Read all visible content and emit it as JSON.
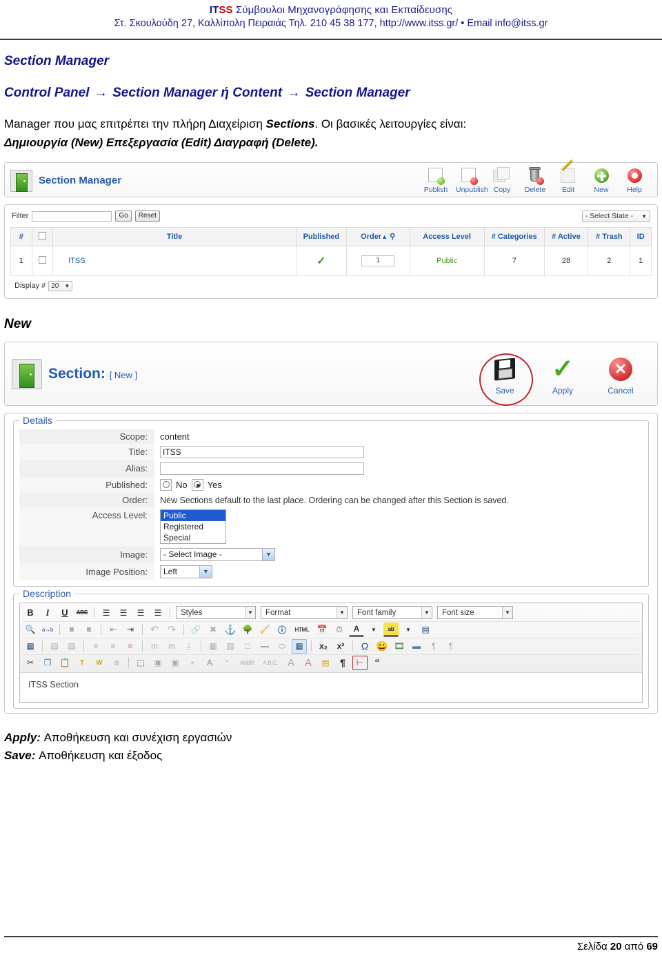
{
  "header": {
    "brand_it": "IT",
    "brand_ss": "SS",
    "line1_rest": " Σύμβουλοι Μηχανογράφησης και Εκπαίδευσης",
    "line2": "Στ. Σκουλούδη 27, Καλλίπολη Πειραιάς Τηλ. 210 45 38 177, http://www.itss.gr/ •  Email info@itss.gr"
  },
  "doc": {
    "title": "Section Manager",
    "breadcrumb_part1": "Control Panel ",
    "breadcrumb_arrow": "→",
    "breadcrumb_part2": " Section Manager ή Content ",
    "breadcrumb_part3": " Section Manager",
    "paragraph_1a": "Manager που μας επιτρέπει την πλήρη Διαχείριση ",
    "paragraph_1b": "Sections",
    "paragraph_1c": ". Οι βασικές λειτουργίες είναι:",
    "paragraph_2": "Δημιουργία (New) Επεξεργασία (Edit) Διαγραφή (Delete).",
    "section_new_heading": "New"
  },
  "section_manager": {
    "title": "Section Manager",
    "toolbar": [
      {
        "label": "Publish",
        "icon": "publish-icon"
      },
      {
        "label": "Unpublish",
        "icon": "unpublish-icon"
      },
      {
        "label": "Copy",
        "icon": "copy-icon"
      },
      {
        "label": "Delete",
        "icon": "delete-icon"
      },
      {
        "label": "Edit",
        "icon": "edit-icon"
      },
      {
        "label": "New",
        "icon": "new-icon"
      },
      {
        "label": "Help",
        "icon": "help-icon"
      }
    ],
    "filter": {
      "label": "Filter",
      "value": "",
      "go_label": "Go",
      "reset_label": "Reset",
      "state_select": "- Select State -"
    },
    "columns": [
      "#",
      "",
      "Title",
      "Published",
      "Order",
      "Access Level",
      "# Categories",
      "# Active",
      "# Trash",
      "ID"
    ],
    "order_sort_arrow": "▲",
    "rows": [
      {
        "num": "1",
        "title": "ITSS",
        "published": "✓",
        "order": "1",
        "access_level": "Public",
        "categories": "7",
        "active": "28",
        "trash": "2",
        "id": "1"
      }
    ],
    "display_label": "Display #",
    "display_value": "20"
  },
  "section_edit": {
    "title": "Section:",
    "title_sub": "[ New ]",
    "actions": [
      {
        "label": "Save",
        "icon": "save-floppy-icon"
      },
      {
        "label": "Apply",
        "icon": "apply-check-icon"
      },
      {
        "label": "Cancel",
        "icon": "cancel-x-icon"
      }
    ],
    "details": {
      "legend": "Details",
      "scope_label": "Scope:",
      "scope_value": "content",
      "title_label": "Title:",
      "title_value": "ITSS",
      "alias_label": "Alias:",
      "alias_value": "",
      "published_label": "Published:",
      "published_no": "No",
      "published_yes": "Yes",
      "order_label": "Order:",
      "order_hint": "New Sections default to the last place. Ordering can be changed after this Section is saved.",
      "access_label": "Access Level:",
      "access_options": [
        "Public",
        "Registered",
        "Special"
      ],
      "access_selected": "Public",
      "image_label": "Image:",
      "image_value": "- Select Image -",
      "image_position_label": "Image Position:",
      "image_position_value": "Left"
    },
    "description": {
      "legend": "Description",
      "dropdowns": [
        "Styles",
        "Format",
        "Font family",
        "Font size"
      ],
      "row1_buttons": [
        {
          "icon": "bold-icon",
          "glyph": "B"
        },
        {
          "icon": "italic-icon",
          "glyph": "I"
        },
        {
          "icon": "underline-icon",
          "glyph": "U"
        },
        {
          "icon": "strikethrough-icon",
          "glyph": "ABC"
        },
        {
          "icon": "align-left-icon",
          "glyph": "≡"
        },
        {
          "icon": "align-center-icon",
          "glyph": "≡"
        },
        {
          "icon": "align-right-icon",
          "glyph": "≡"
        },
        {
          "icon": "align-justify-icon",
          "glyph": "≡"
        }
      ],
      "row2_buttons": [
        {
          "icon": "search-icon",
          "glyph": "🔍"
        },
        {
          "icon": "replace-icon",
          "glyph": "ab"
        },
        {
          "icon": "bullet-list-icon",
          "glyph": "☰"
        },
        {
          "icon": "numbered-list-icon",
          "glyph": "☰"
        },
        {
          "icon": "outdent-icon",
          "glyph": "⇤"
        },
        {
          "icon": "indent-icon",
          "glyph": "⇥"
        },
        {
          "icon": "undo-icon",
          "glyph": "↶"
        },
        {
          "icon": "redo-icon",
          "glyph": "↷"
        },
        {
          "icon": "link-icon",
          "glyph": "🔗"
        },
        {
          "icon": "unlink-icon",
          "glyph": "✂"
        },
        {
          "icon": "anchor-icon",
          "glyph": "⚓"
        },
        {
          "icon": "insert-image-icon",
          "glyph": "🌳"
        },
        {
          "icon": "cleanup-icon",
          "glyph": "🧹"
        },
        {
          "icon": "help-icon",
          "glyph": "?"
        },
        {
          "icon": "html-source-icon",
          "glyph": "HTML"
        },
        {
          "icon": "insert-date-icon",
          "glyph": "📅"
        },
        {
          "icon": "insert-time-icon",
          "glyph": "🕒"
        },
        {
          "icon": "text-color-icon",
          "glyph": "A"
        },
        {
          "icon": "text-color-dropdown-icon",
          "glyph": "▾"
        },
        {
          "icon": "highlight-color-icon",
          "glyph": "ab"
        },
        {
          "icon": "highlight-dropdown-icon",
          "glyph": "▾"
        },
        {
          "icon": "fullscreen-icon",
          "glyph": "▤"
        }
      ],
      "row3_buttons": [
        {
          "icon": "edit-table-icon",
          "glyph": "▦"
        },
        {
          "icon": "insert-row-before-icon",
          "glyph": "▤"
        },
        {
          "icon": "insert-row-after-icon",
          "glyph": "▤"
        },
        {
          "icon": "table-row-props-icon",
          "glyph": "≡"
        },
        {
          "icon": "delete-row-icon",
          "glyph": "≡"
        },
        {
          "icon": "merge-cells-icon",
          "glyph": "≡"
        },
        {
          "icon": "insert-col-before-icon",
          "glyph": "m"
        },
        {
          "icon": "insert-col-after-icon",
          "glyph": "m"
        },
        {
          "icon": "delete-col-icon",
          "glyph": "⤓"
        },
        {
          "icon": "table-grid-icon",
          "glyph": "▦"
        },
        {
          "icon": "split-cell-icon",
          "glyph": "▧"
        },
        {
          "icon": "page-break-icon",
          "glyph": "□"
        },
        {
          "icon": "horizontal-rule-icon",
          "glyph": "—"
        },
        {
          "icon": "eraser-icon",
          "glyph": "⬭"
        },
        {
          "icon": "insert-table-icon",
          "glyph": "▦"
        },
        {
          "icon": "subscript-icon",
          "glyph": "x₂"
        },
        {
          "icon": "superscript-icon",
          "glyph": "x²"
        },
        {
          "icon": "special-char-icon",
          "glyph": "Ω"
        },
        {
          "icon": "emoticon-icon",
          "glyph": "☺"
        },
        {
          "icon": "insert-media-icon",
          "glyph": "🎞"
        },
        {
          "icon": "insert-embed-icon",
          "glyph": "▬"
        },
        {
          "icon": "ltr-icon",
          "glyph": "¶"
        },
        {
          "icon": "rtl-icon",
          "glyph": "¶"
        }
      ],
      "row4_buttons": [
        {
          "icon": "cut-icon",
          "glyph": "✂"
        },
        {
          "icon": "copy-icon",
          "glyph": "❐"
        },
        {
          "icon": "paste-icon",
          "glyph": "📋"
        },
        {
          "icon": "paste-text-icon",
          "glyph": "T"
        },
        {
          "icon": "paste-word-icon",
          "glyph": "W"
        },
        {
          "icon": "remove-format-icon",
          "glyph": "a"
        },
        {
          "icon": "select-all-icon",
          "glyph": "⬚"
        },
        {
          "icon": "layer-back-icon",
          "glyph": "▣"
        },
        {
          "icon": "layer-front-icon",
          "glyph": "▣"
        },
        {
          "icon": "insert-layer-icon",
          "glyph": "+"
        },
        {
          "icon": "style-a-icon",
          "glyph": "A"
        },
        {
          "icon": "quote-icon",
          "glyph": "“”"
        },
        {
          "icon": "abbr-icon",
          "glyph": "ABBR"
        },
        {
          "icon": "acronym-icon",
          "glyph": "A.B.C."
        },
        {
          "icon": "insert-attribute-icon",
          "glyph": "A"
        },
        {
          "icon": "delete-attribute-icon",
          "glyph": "A"
        },
        {
          "icon": "attributes-icon",
          "glyph": "▤"
        },
        {
          "icon": "paragraph-marks-icon",
          "glyph": "¶"
        },
        {
          "icon": "nonbreaking-icon",
          "glyph": "⊠"
        },
        {
          "icon": "blockquote-icon",
          "glyph": "“"
        }
      ],
      "content": "ITSS Section"
    }
  },
  "legend": {
    "apply_key": "Apply:",
    "apply_value": "Αποθήκευση και συνέχιση εργασιών",
    "save_key": "Save:",
    "save_value": "Αποθήκευση και έξοδος"
  },
  "footer": {
    "prefix": "Σελίδα",
    "page": "20",
    "middle": "από",
    "total": "69"
  }
}
